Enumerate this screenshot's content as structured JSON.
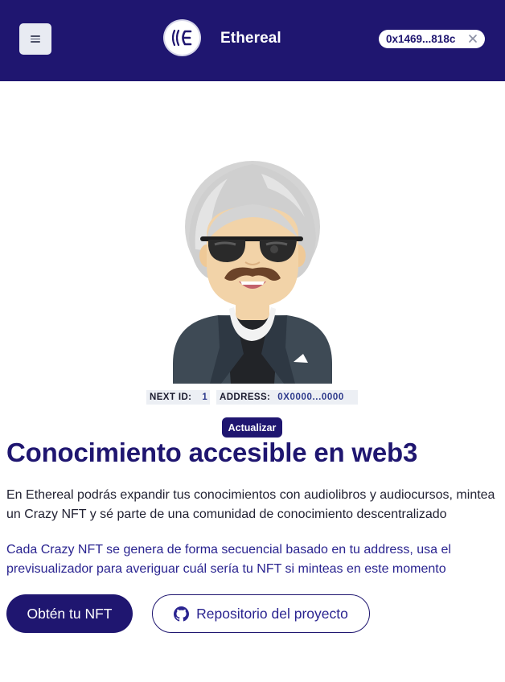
{
  "header": {
    "brand": "Ethereal",
    "logo_text": "IIE",
    "wallet_address": "0x1469...818c",
    "menu_icon": "hamburger-icon",
    "close_icon": "close-icon"
  },
  "preview": {
    "next_id_label": "NEXT ID:",
    "next_id_value": "1",
    "address_label": "ADDRESS:",
    "address_value": "0X0000...0000",
    "refresh_label": "Actualizar"
  },
  "hero": {
    "title": "Conocimiento accesible en web3",
    "paragraph_1": "En Ethereal podrás expandir tus conocimientos con audiolibros y audiocursos, mintea un Crazy NFT y sé parte de una comunidad de conocimiento descentralizado",
    "paragraph_2": "Cada Crazy NFT se genera de forma secuencial basado en tu address, usa el previsualizador para averiguar cuál sería tu NFT si minteas en este momento",
    "primary_button": "Obtén tu NFT",
    "secondary_button": "Repositorio del proyecto",
    "github_icon": "github-icon"
  },
  "colors": {
    "primary": "#1f1670",
    "accent_text": "#2a2490",
    "tag_bg": "#eceff4"
  }
}
